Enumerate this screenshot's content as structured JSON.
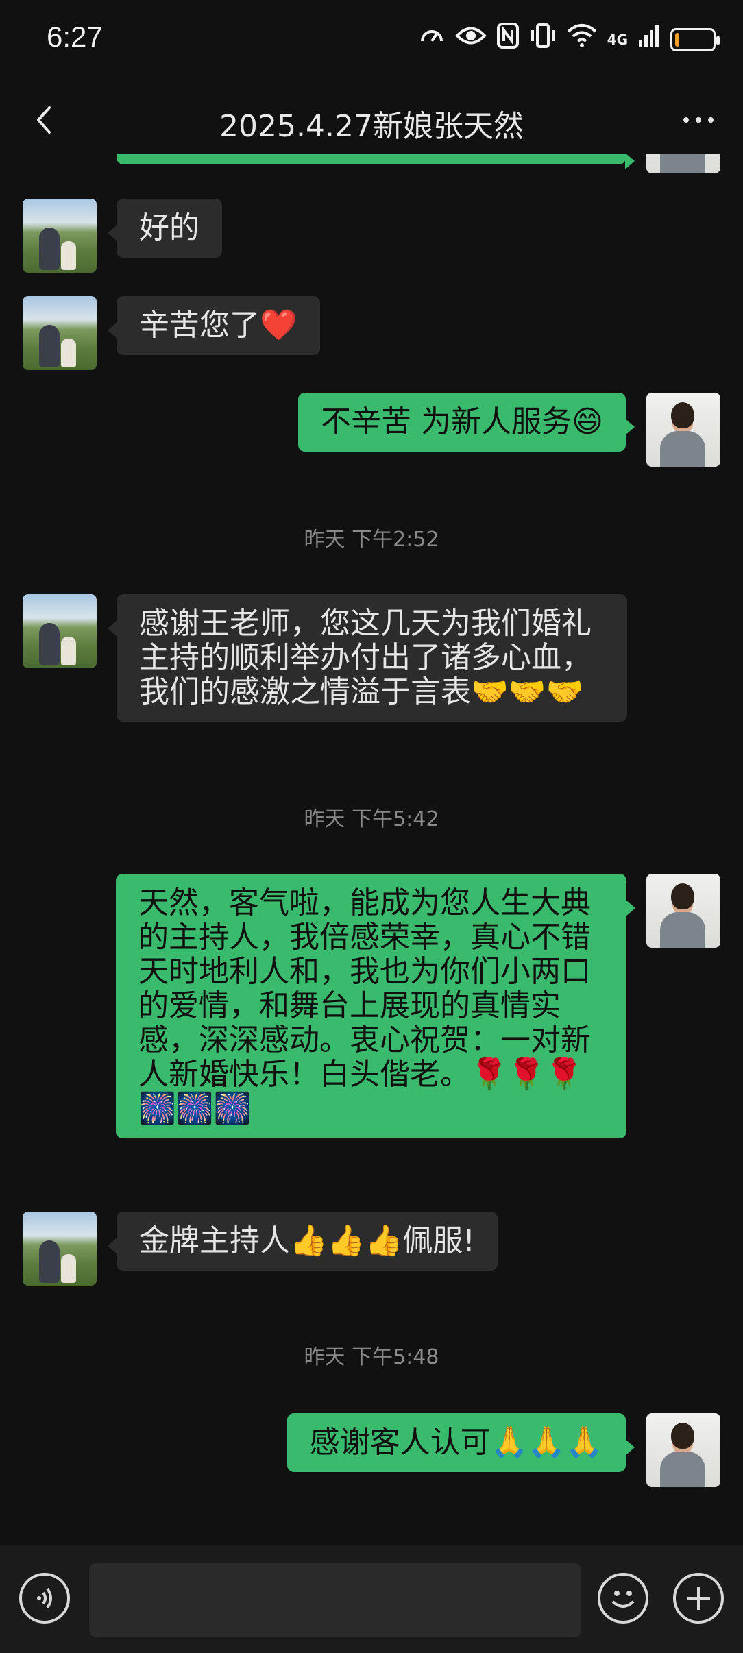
{
  "status_bar": {
    "time": "6:27",
    "network": "4G",
    "battery_level": 0.12
  },
  "header": {
    "title": "2025.4.27新娘张天然",
    "back_icon": "chevron-left-icon",
    "more_icon": "more-horizontal-icon"
  },
  "messages": [
    {
      "type": "text",
      "sender": "bride",
      "text": "好的"
    },
    {
      "type": "text",
      "sender": "bride",
      "text": "辛苦您了❤️"
    },
    {
      "type": "text",
      "sender": "host",
      "text": "不辛苦 为新人服务😄"
    },
    {
      "type": "time",
      "text": "昨天 下午2:52"
    },
    {
      "type": "text",
      "sender": "bride",
      "text": "感谢王老师，您这几天为我们婚礼主持的顺利举办付出了诸多心血，我们的感激之情溢于言表🤝🤝🤝"
    },
    {
      "type": "time",
      "text": "昨天 下午5:42"
    },
    {
      "type": "text",
      "sender": "host",
      "text": "天然，客气啦，能成为您人生大典的主持人，我倍感荣幸，真心不错天时地利人和，我也为你们小两口的爱情，和舞台上展现的真情实感，深深感动。衷心祝贺：一对新人新婚快乐！白头偕老。🌹🌹🌹🎆🎆🎆"
    },
    {
      "type": "text",
      "sender": "bride",
      "text": "金牌主持人👍👍👍佩服!"
    },
    {
      "type": "time",
      "text": "昨天 下午5:48"
    },
    {
      "type": "text",
      "sender": "host",
      "text": "感谢客人认可🙏🙏🙏"
    }
  ],
  "input_bar": {
    "voice_icon": "voice-input-icon",
    "emoji_icon": "emoji-icon",
    "plus_icon": "plus-icon",
    "placeholder": ""
  },
  "colors": {
    "background": "#111111",
    "incoming_bubble": "#2c2c2c",
    "outgoing_bubble": "#3aba6d",
    "timestamp": "#8a8a8a"
  }
}
